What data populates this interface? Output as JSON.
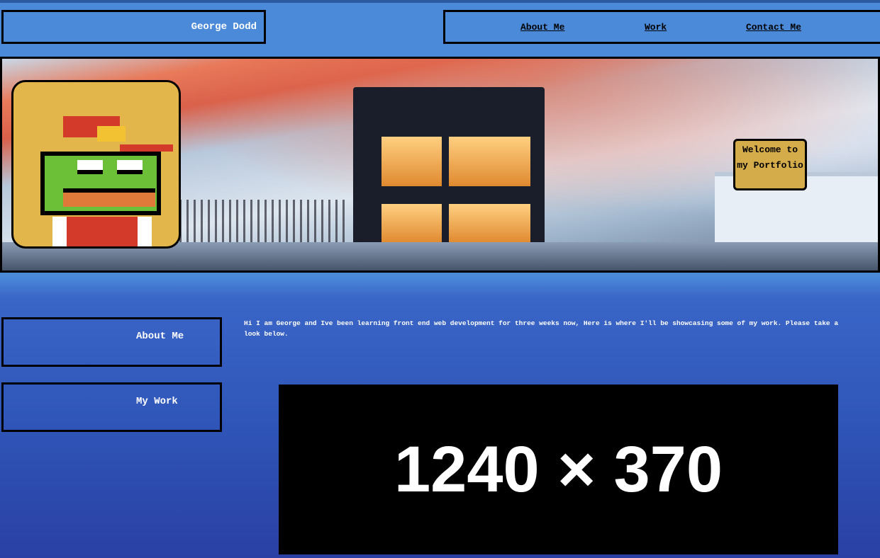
{
  "header": {
    "name": "George Dodd"
  },
  "nav": [
    {
      "label": "About Me"
    },
    {
      "label": "Work"
    },
    {
      "label": "Contact Me"
    }
  ],
  "hero": {
    "welcome": "Welcome to my Portfolio"
  },
  "sidebar": [
    {
      "label": "About Me"
    },
    {
      "label": "My Work"
    }
  ],
  "intro": "Hi I am George and Ive been learning front end web development for three weeks now, Here is where I'll be showcasing some of my work. Please take a look below.",
  "placeholder": {
    "text": "1240 × 370"
  }
}
